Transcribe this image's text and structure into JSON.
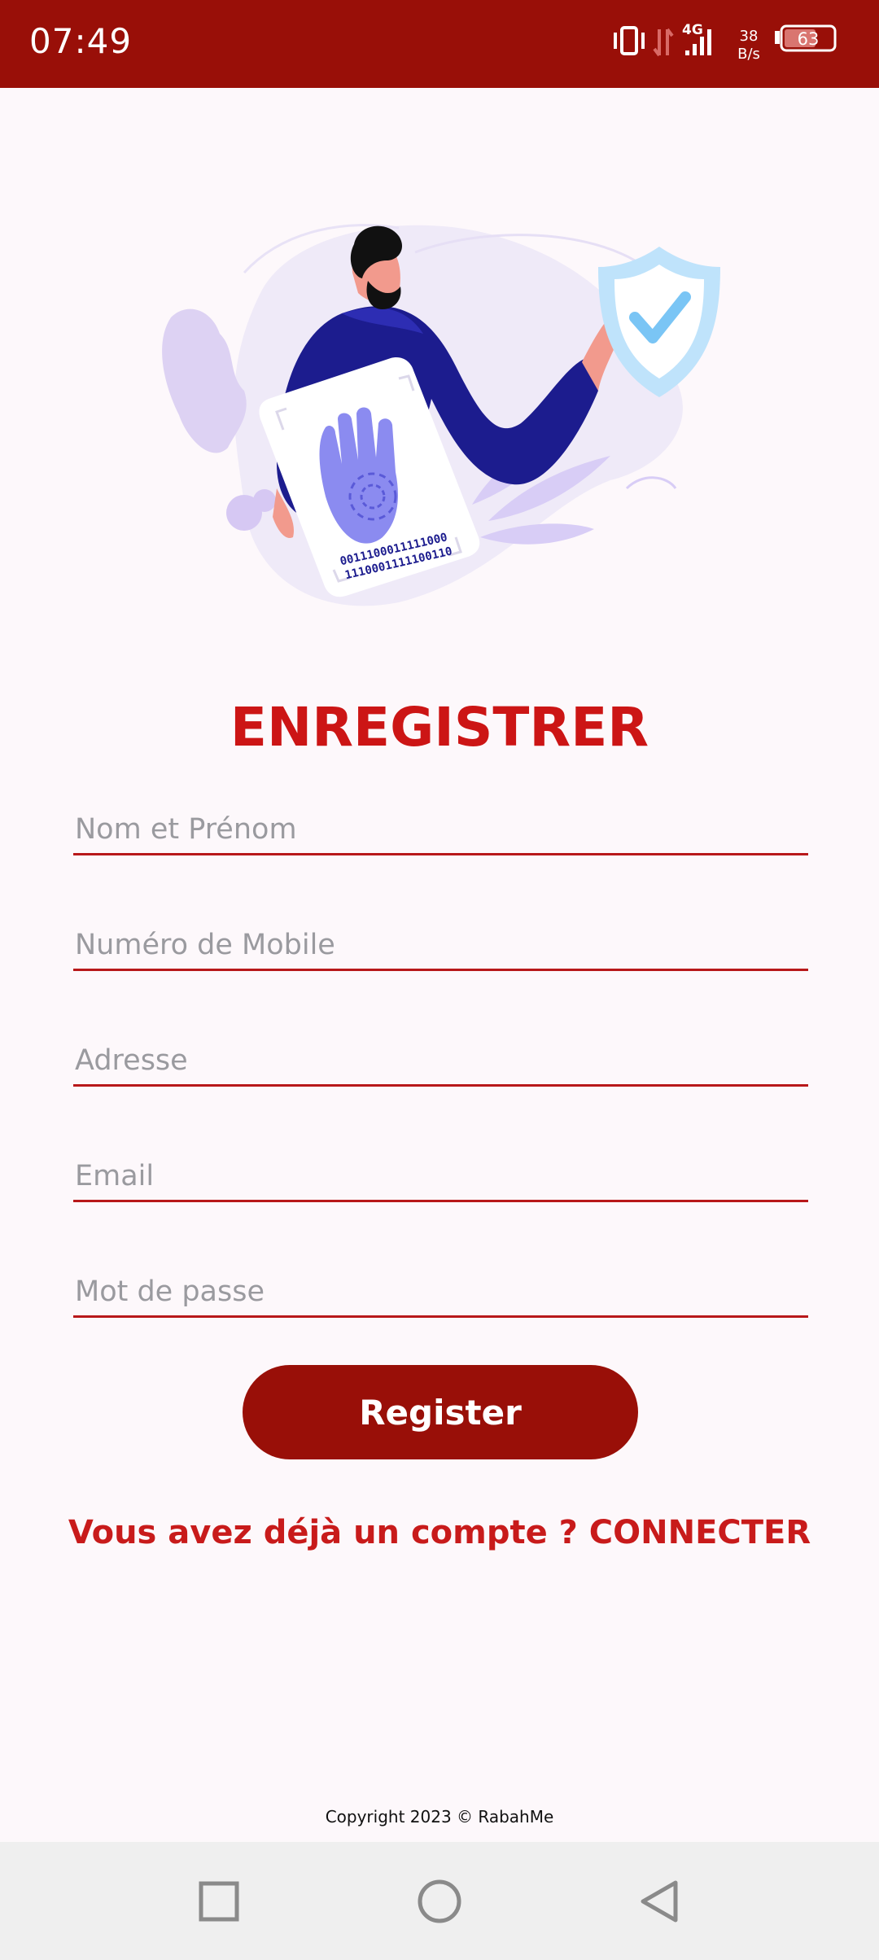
{
  "status_bar": {
    "time": "07:49",
    "network": "4G",
    "speed_value": "38",
    "speed_unit": "B/s",
    "battery": "63",
    "icons": [
      "vibrate-icon",
      "data-arrows-icon",
      "signal-icon",
      "battery-icon"
    ]
  },
  "hero": {
    "icons": [
      "fingerprint-card-illustration",
      "shield-check-icon"
    ],
    "binary_line1": "0011100011111000",
    "binary_line2": "1110001111100110"
  },
  "form": {
    "title": "ENREGISTRER",
    "name_placeholder": "Nom et Prénom",
    "mobile_placeholder": "Numéro de Mobile",
    "address_placeholder": "Adresse",
    "email_placeholder": "Email",
    "password_placeholder": "Mot de passe",
    "register_label": "Register",
    "login_prompt": "Vous avez déjà un compte ? CONNECTER"
  },
  "footer": {
    "copyright": "Copyright 2023 © RabahMe"
  },
  "nav": {
    "icons": [
      "recents-square-icon",
      "home-circle-icon",
      "back-triangle-icon"
    ]
  },
  "colors": {
    "brand": "#990f08",
    "accent_text": "#cc1515",
    "background": "#fdf8fb"
  }
}
